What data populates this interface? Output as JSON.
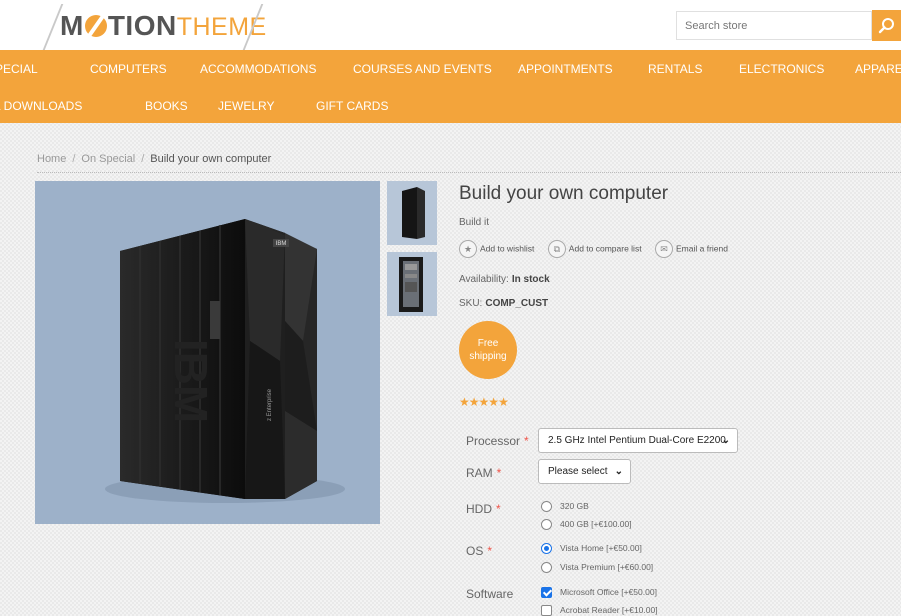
{
  "header": {
    "logo": {
      "part1": "M",
      "part2": "TION",
      "part3": "THEME"
    },
    "search": {
      "placeholder": "Search store",
      "icon": "search-icon"
    }
  },
  "nav": {
    "row1": [
      "SPECIAL",
      "COMPUTERS",
      "ACCOMMODATIONS",
      "COURSES AND EVENTS",
      "APPOINTMENTS",
      "RENTALS",
      "ELECTRONICS",
      "APPAREL"
    ],
    "row2": [
      "DIGITAL DOWNLOADS",
      "BOOKS",
      "JEWELRY",
      "GIFT CARDS"
    ]
  },
  "breadcrumb": {
    "home": "Home",
    "category": "On Special",
    "current": "Build your own computer",
    "separator": "/"
  },
  "product": {
    "title": "Build your own computer",
    "short_description": "Build it",
    "actions": {
      "wishlist": "Add to wishlist",
      "compare": "Add to compare list",
      "email": "Email a friend"
    },
    "availability_label": "Availability:",
    "availability_value": "In stock",
    "sku_label": "SKU:",
    "sku_value": "COMP_CUST",
    "free_shipping": {
      "line1": "Free",
      "line2": "shipping"
    },
    "rating_stars": 5,
    "image_brand": "IBM",
    "image_side_label": "z Enterprise"
  },
  "attributes": {
    "required_marker": "*",
    "processor": {
      "label": "Processor",
      "selected": "2.5 GHz Intel Pentium Dual-Core E2200"
    },
    "ram": {
      "label": "RAM",
      "selected": "Please select"
    },
    "hdd": {
      "label": "HDD",
      "options": [
        {
          "label": "320 GB",
          "checked": false
        },
        {
          "label": "400 GB [+€100.00]",
          "checked": false
        }
      ]
    },
    "os": {
      "label": "OS",
      "options": [
        {
          "label": "Vista Home [+€50.00]",
          "checked": true
        },
        {
          "label": "Vista Premium [+€60.00]",
          "checked": false
        }
      ]
    },
    "software": {
      "label": "Software",
      "options": [
        {
          "label": "Microsoft Office [+€50.00]",
          "checked": true
        },
        {
          "label": "Acrobat Reader [+€10.00]",
          "checked": false
        }
      ]
    }
  },
  "colors": {
    "accent": "#f3a43b",
    "checked": "#1a73e8",
    "required": "#f0554a",
    "image_bg": "#9db1c9"
  }
}
